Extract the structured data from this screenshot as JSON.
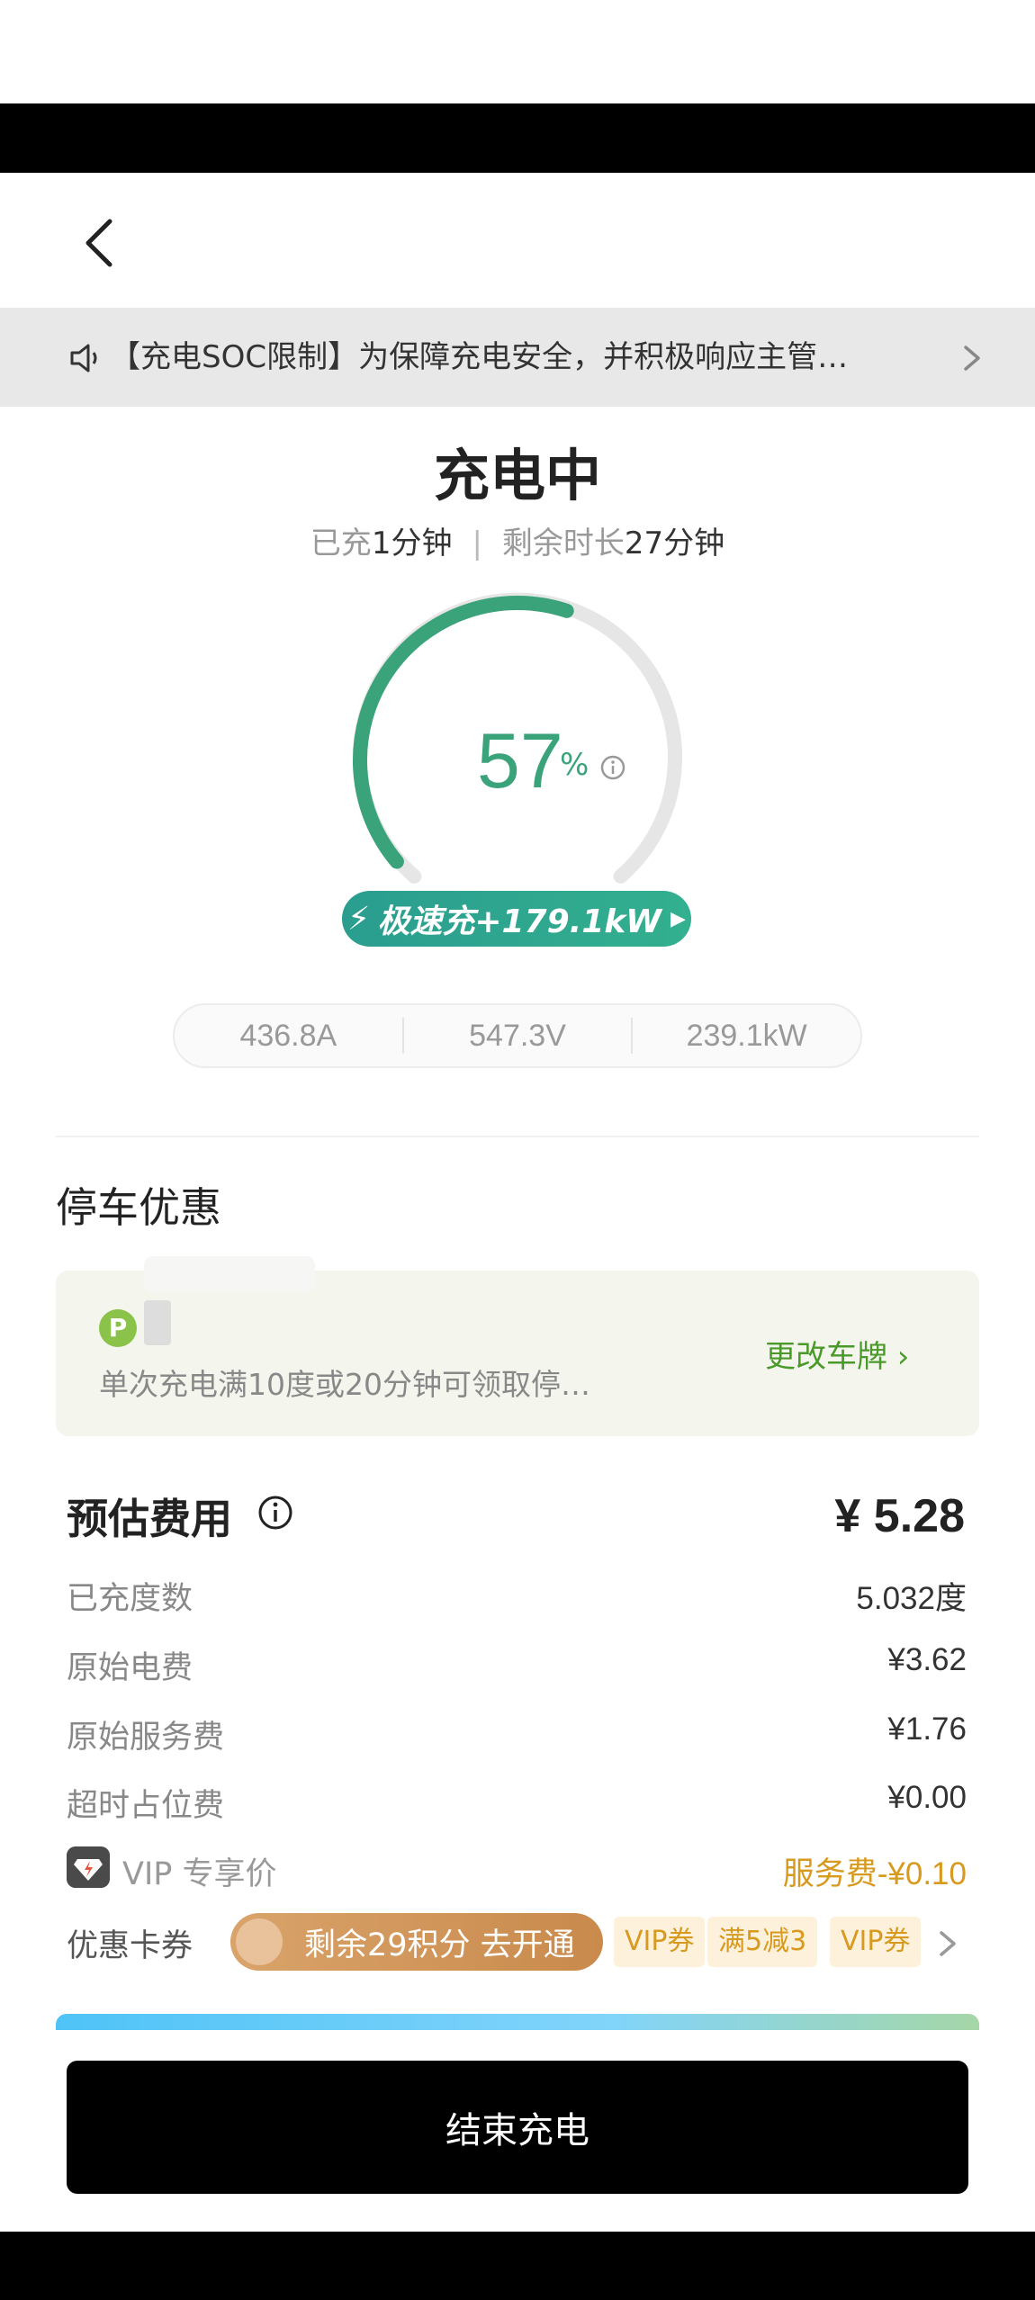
{
  "nav": {
    "back_icon": "chevron-left-icon"
  },
  "notice": {
    "icon": "speaker-icon",
    "text": "【充电SOC限制】为保障充电安全，并积极响应主管…"
  },
  "status": {
    "title": "充电中",
    "charged_label": "已充",
    "charged_value": "1分钟",
    "remaining_label": "剩余时长",
    "remaining_value": "27分钟"
  },
  "gauge": {
    "percent": 57,
    "percent_text": "57",
    "percent_sign": "%",
    "color": "#3aa37a"
  },
  "speed": {
    "label": "极速充+179.1kW"
  },
  "metrics": [
    "436.8A",
    "547.3V",
    "239.1kW"
  ],
  "parking": {
    "title": "停车优惠",
    "p_badge": "P",
    "description": "单次充电满10度或20分钟可领取停…",
    "action": "更改车牌 ›"
  },
  "fees": {
    "title": "预估费用",
    "total": "¥ 5.28",
    "rows": [
      {
        "label": "已充度数",
        "value": "5.032度"
      },
      {
        "label": "原始电费",
        "value": "¥3.62"
      },
      {
        "label": "原始服务费",
        "value": "¥1.76"
      },
      {
        "label": "超时占位费",
        "value": "¥0.00"
      }
    ],
    "vip_label": "VIP 专享价",
    "vip_value": "服务费-¥0.10"
  },
  "coupons": {
    "label": "优惠卡券",
    "pill": "剩余29积分 去开通",
    "tags": [
      "VIP券",
      "满5减3",
      "VIP券"
    ]
  },
  "end_button": "结束充电"
}
